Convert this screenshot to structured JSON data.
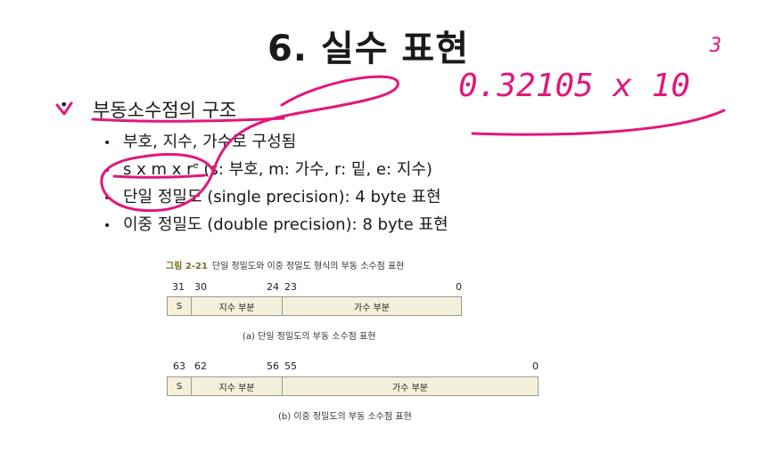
{
  "slide": {
    "title": "6. 실수 표현",
    "bullet_main": "부동소수점의 구조",
    "sub_bullets": [
      "부호, 지수, 가수로 구성됨",
      "(s: 부호, m: 가수, r: 밑, e: 지수)",
      "단일 정밀도 (single precision): 4 byte 표현",
      "이중 정밀도 (double precision): 8 byte 표현"
    ],
    "formula_base": "s x m x r",
    "formula_exp": "e"
  },
  "figure": {
    "caption_lead": "그림 2-21",
    "caption_text": "단일 정밀도와 이중 정밀도 형식의 부동 소수점 표현",
    "single": {
      "bits": [
        "31",
        "30",
        "24",
        "23",
        "0"
      ],
      "fields": [
        "S",
        "지수 부분",
        "가수 부분"
      ],
      "caption": "(a) 단일 정밀도의 부동 소수점 표현"
    },
    "double": {
      "bits": [
        "63",
        "62",
        "56",
        "55",
        "0"
      ],
      "fields": [
        "S",
        "지수 부분",
        "가수 부분"
      ],
      "caption": "(b) 이중 정밀도의 부동 소수점 표현"
    }
  },
  "annotations": {
    "handwriting": "0.32105 x 10",
    "handwriting_exp": "3",
    "ink_color": "#e0187c"
  }
}
